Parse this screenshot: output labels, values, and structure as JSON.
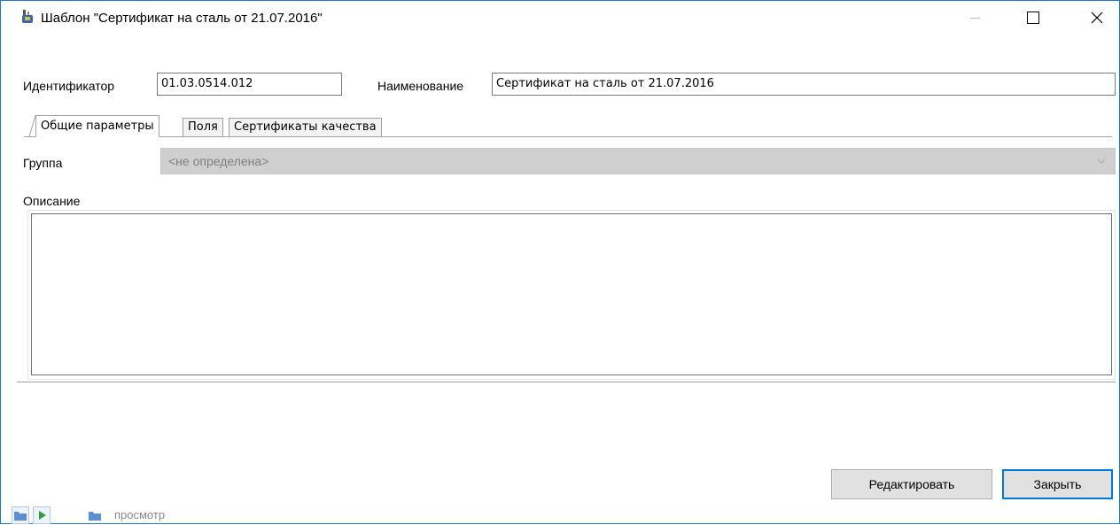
{
  "window": {
    "title": "Шаблон \"Сертификат на сталь от 21.07.2016\"",
    "icons": [
      "app-icon",
      "minimize-icon",
      "maximize-icon",
      "close-icon"
    ]
  },
  "header": {
    "identifier_label": "Идентификатор",
    "identifier_value": "01.03.0514.012",
    "name_label": "Наименование",
    "name_value": "Сертификат на сталь от 21.07.2016"
  },
  "tabs": [
    {
      "label": "Общие параметры",
      "active": true
    },
    {
      "label": "Поля",
      "active": false
    },
    {
      "label": "Сертификаты качества",
      "active": false
    }
  ],
  "general": {
    "group_label": "Группа",
    "group_value": "<не определена>",
    "description_label": "Описание",
    "description_value": ""
  },
  "buttons": {
    "edit": "Редактировать",
    "close": "Закрыть"
  },
  "statusbar": {
    "text": "просмотр"
  },
  "colors": {
    "window_border": "#1979ca",
    "button_focus": "#0078d7",
    "combo_disabled_bg": "#cfcfcf",
    "play_green": "#2e9b3c",
    "folder_blue": "#5b8fd0"
  }
}
